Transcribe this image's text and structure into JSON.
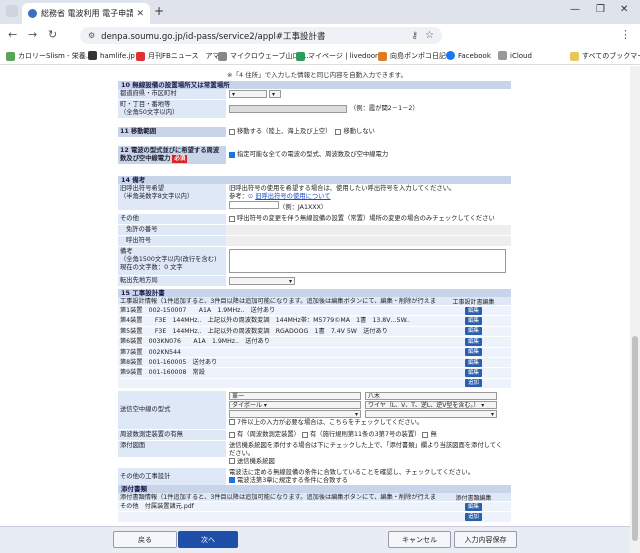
{
  "browser": {
    "tab_title": "総務省 電波利用 電子申請・届出",
    "url": "denpa.soumu.go.jp/id-pass/service2/appl#工事設計書",
    "bookmarks": [
      "カロリーSlism - 栄養...",
      "hamlife.jp",
      "月刊FBニュース　アマ...",
      "マイクロウェーブ山口 -...",
      "マイページ | livedoor...",
      "向島ポンポコ日記",
      "Facebook",
      "iCloud"
    ],
    "all_bookmarks": "すべてのブックマーク"
  },
  "page": {
    "top_note": "※「4 住所」で入力した情報と同じ内容を自動入力できます。",
    "sec10": {
      "title": "10 無線設備の設置場所又は常置場所",
      "pref_label": "都道府県・市区町村",
      "addr_label": "町・丁目・番地等\n（全角50文字以内）",
      "addr_example": "（例：霞が関2－1－2）"
    },
    "sec11": {
      "title": "11 移動範囲",
      "opt1": "移動する（陸上、海上及び上空）",
      "opt2": "移動しない"
    },
    "sec12": {
      "title": "12 電波の型式並びに希望する周波数及び空中線電力",
      "req": "必須",
      "check": "指定可能な全ての電波の型式、周波数及び空中線電力"
    },
    "sec14": {
      "title": "14 備考",
      "old_sign_label": "旧呼出符号希望\n（半角英数字8文字以内）",
      "old_sign_desc": "旧呼出符号の使用を希望する場合は、使用したい呼出符号を入力してください。",
      "ref": "参考：",
      "ref_link": "旧呼出符号の使用について",
      "sign_example": "（例：JA1XXX）",
      "other_label": "その他",
      "other_check": "呼出符号の変更を伴う無線設備の設置（常置）場所の変更の場合のみチェックしてください",
      "license_no": "免許の番号",
      "callsign": "呼出符号",
      "remarks_label": "備考\n（全角1500文字以内(改行を含む)\n現在の文字数：0 文字",
      "transfer_label": "転出先地方局"
    },
    "sec15": {
      "title": "15 工事設計書",
      "info_header": "工事設計情報（1件追加すると、3件目以降は追加可能になります。追加後は編集ボタンにて、編集・削除が行えます。）",
      "edit_header": "工事設計書編集",
      "rows": [
        "第1装置　002-150007　　A1A　1.9MHz..　送付あり",
        "第4装置　　F3E　144MHz..　上記以外の周波数変調　144MHz帯：M5779©MA　1書　13.8V…5W..",
        "第5装置　　F3E　144MHz..　上記以外の周波数変調　RGADOOG　1書　7.4V 5W　送付あり",
        "第6装置　003KN076　　A1A　1.9MHz..　送付あり",
        "第7装置　002KN544",
        "第8装置　001-160005　送付あり",
        "第9装置　001-160008　常設"
      ],
      "edit_btn": "編集",
      "add_btn": "追加",
      "tx_type_label": "送信空中線の型式",
      "sel1": "單一",
      "sel2": "ダイポール",
      "sel3": "",
      "sel4": "八木",
      "sel5": "ワイヤ（L、V、T、逆L、逆V型を含む。）",
      "sel6": "",
      "tx_check": "7件以上の入力が必要な場合は、こちらをチェックしてください。",
      "freq_label": "周波数測定装置の有無",
      "freq_opt1": "有（周波数測定装置）",
      "freq_opt2": "有（施行規則第11条の3第7号の装置）",
      "freq_opt3": "無",
      "diag_label": "添付図面",
      "diag_desc": "送信機系統図を添付する場合は下にチェックした上で、「添付書類」欄より当該図面を添付してください。",
      "diag_check": "送信機系統図",
      "other_label": "その他の工事設計",
      "other_desc": "電波法に定める無線設備の条件に合致していることを確認し、チェックしてください。",
      "other_check": "電波法第3章に規定する条件に合致する"
    },
    "attach": {
      "title": "添付書類",
      "header": "添付書類情報（1件追加すると、3件目以降は追加可能になります。追加後は編集ボタンにて、編集・削除が行えます。）",
      "edit_header": "添付書類編集",
      "row": "その他　付属装置諸元.pdf",
      "edit_btn": "編集",
      "add_btn": "追加"
    },
    "footer": {
      "back": "戻る",
      "next": "次へ",
      "cancel": "キャンセル",
      "save": "入力内容保存"
    }
  }
}
